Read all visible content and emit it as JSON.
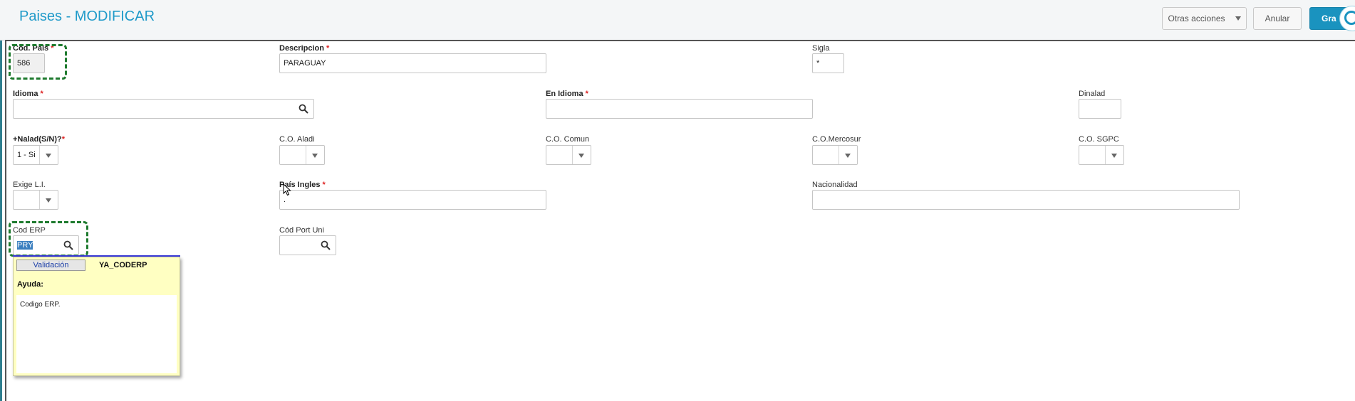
{
  "header": {
    "title": "Paises - MODIFICAR",
    "buttons": {
      "otras": "Otras acciones",
      "anular": "Anular",
      "grabar": "Gra"
    }
  },
  "form": {
    "cod_pais": {
      "label": "Cód. País",
      "value": "586"
    },
    "descripcion": {
      "label": "Descripcion",
      "value": "PARAGUAY"
    },
    "sigla": {
      "label": "Sigla",
      "value": "*"
    },
    "idioma": {
      "label": "Idioma",
      "value": ""
    },
    "en_idioma": {
      "label": "En Idioma",
      "value": ""
    },
    "dinalad": {
      "label": "Dinalad",
      "value": ""
    },
    "nalad": {
      "label": "+Nalad(S/N)?",
      "value": "1 - Si"
    },
    "co_aladi": {
      "label": "C.O. Aladi",
      "value": ""
    },
    "co_comun": {
      "label": "C.O. Comun",
      "value": ""
    },
    "co_mercosur": {
      "label": "C.O.Mercosur",
      "value": ""
    },
    "co_sgpc": {
      "label": "C.O. SGPC",
      "value": ""
    },
    "exige_li": {
      "label": "Exige L.I.",
      "value": ""
    },
    "pais_ingles": {
      "label": "País Ingles",
      "value": "."
    },
    "nacionalidad": {
      "label": "Nacionalidad",
      "value": ""
    },
    "cod_erp": {
      "label": "Cod ERP",
      "value": "PRY"
    },
    "cod_port_uni": {
      "label": "Cód Port Uni",
      "value": ""
    }
  },
  "help_popup": {
    "button": "Validación",
    "field_code": "YA_CODERP",
    "section_label": "Ayuda:",
    "text": "Codigo ERP."
  },
  "required_mark": "*",
  "colors": {
    "accent": "#1a93bf",
    "title": "#1f9ac9",
    "required": "#dd2222",
    "focus_outline": "#1e7a2e",
    "help_bg": "#ffffc2"
  }
}
